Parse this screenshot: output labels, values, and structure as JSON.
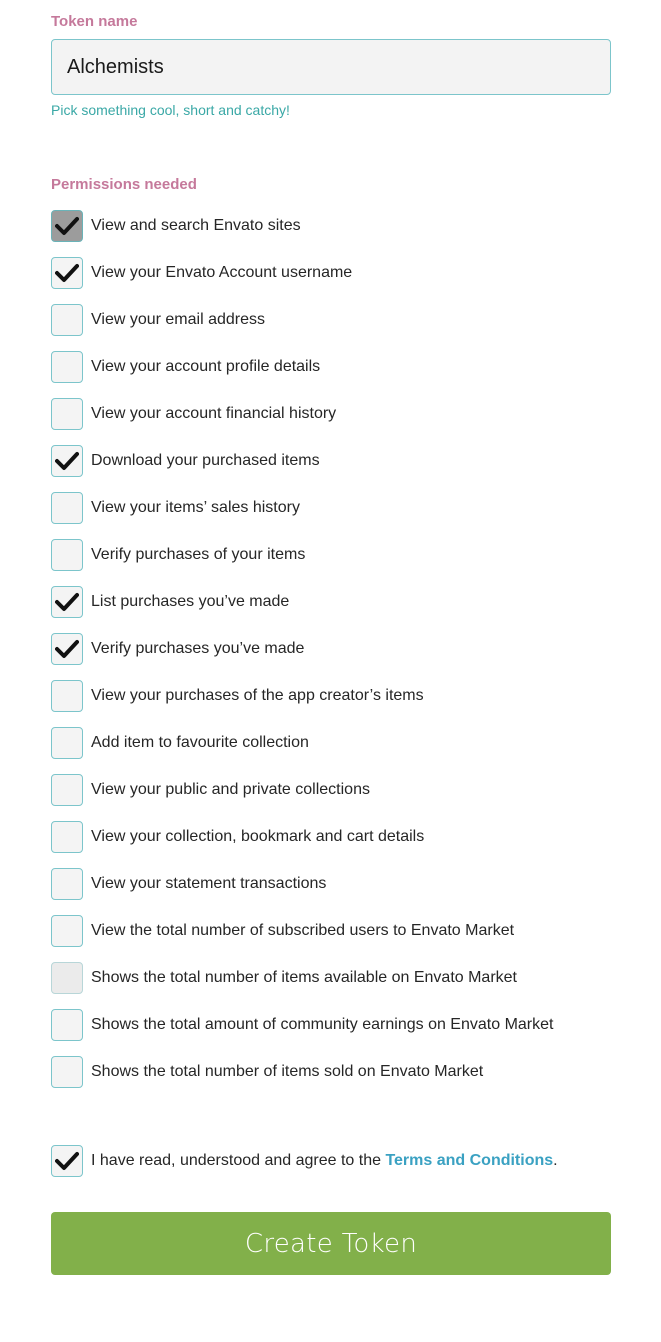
{
  "token": {
    "label": "Token name",
    "value": "Alchemists",
    "hint": "Pick something cool, short and catchy!"
  },
  "permissions": {
    "label": "Permissions needed",
    "items": [
      {
        "label": "View and search Envato sites",
        "state": "disabled-checked"
      },
      {
        "label": "View your Envato Account username",
        "state": "checked"
      },
      {
        "label": "View your email address",
        "state": "unchecked"
      },
      {
        "label": "View your account profile details",
        "state": "unchecked"
      },
      {
        "label": "View your account financial history",
        "state": "unchecked"
      },
      {
        "label": "Download your purchased items",
        "state": "checked"
      },
      {
        "label": "View your items’ sales history",
        "state": "unchecked"
      },
      {
        "label": "Verify purchases of your items",
        "state": "unchecked"
      },
      {
        "label": "List purchases you’ve made",
        "state": "checked"
      },
      {
        "label": "Verify purchases you’ve made",
        "state": "checked"
      },
      {
        "label": "View your purchases of the app creator’s items",
        "state": "unchecked"
      },
      {
        "label": "Add item to favourite collection",
        "state": "unchecked"
      },
      {
        "label": "View your public and private collections",
        "state": "unchecked"
      },
      {
        "label": "View your collection, bookmark and cart details",
        "state": "unchecked"
      },
      {
        "label": "View your statement transactions",
        "state": "unchecked"
      },
      {
        "label": "View the total number of subscribed users to Envato Market",
        "state": "unchecked"
      },
      {
        "label": "Shows the total number of items available on Envato Market",
        "state": "disabled"
      },
      {
        "label": "Shows the total amount of community earnings on Envato Market",
        "state": "unchecked"
      },
      {
        "label": "Shows the total number of items sold on Envato Market",
        "state": "unchecked"
      }
    ]
  },
  "agree": {
    "state": "checked",
    "text": "I have read, understood and agree to the ",
    "link": "Terms and Conditions",
    "suffix": "."
  },
  "create_button": {
    "label": "Create Token"
  },
  "colors": {
    "label": "#c5799b",
    "hint": "#3aa8a6",
    "border": "#7cc5cb",
    "link": "#3aa1c2",
    "button": "#82b04a"
  },
  "icons": {
    "check": "checkmark-icon"
  }
}
